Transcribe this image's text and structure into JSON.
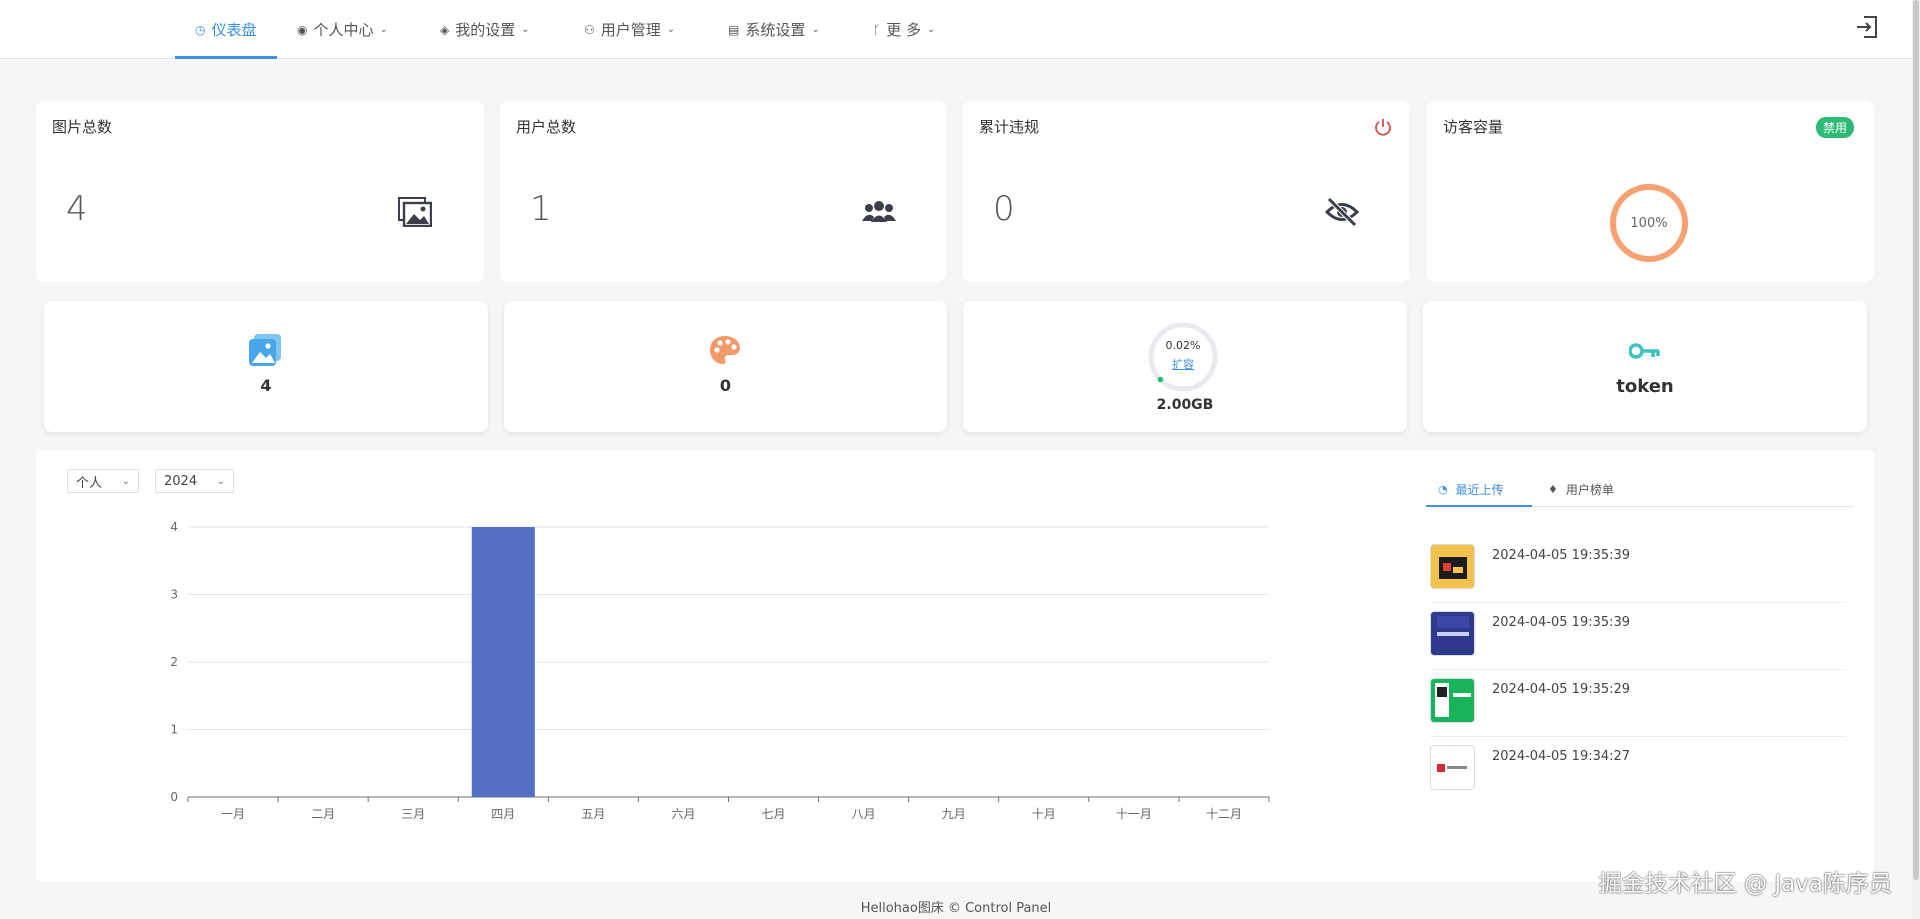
{
  "nav": {
    "items": [
      {
        "label": "仪表盘",
        "icon": "dashboard-icon",
        "active": true
      },
      {
        "label": "个人中心",
        "icon": "user-circle-icon"
      },
      {
        "label": "我的设置",
        "icon": "paint-bucket-icon"
      },
      {
        "label": "用户管理",
        "icon": "users-icon"
      },
      {
        "label": "系统设置",
        "icon": "server-icon"
      },
      {
        "label": "更 多",
        "icon": "branch-icon"
      }
    ]
  },
  "stats": {
    "images": {
      "title": "图片总数",
      "value": "4"
    },
    "users": {
      "title": "用户总数",
      "value": "1"
    },
    "violations": {
      "title": "累计违规",
      "value": "0"
    },
    "visitor": {
      "title": "访客容量",
      "badge": "禁用",
      "percent": "100%"
    }
  },
  "mini": {
    "images": {
      "value": "4"
    },
    "palette": {
      "value": "0"
    },
    "storage": {
      "percent": "0.02%",
      "link": "扩容",
      "value": "2.00GB"
    },
    "token": {
      "value": "token"
    }
  },
  "filters": {
    "scope": "个人",
    "year": "2024"
  },
  "chart_data": {
    "type": "bar",
    "categories": [
      "一月",
      "二月",
      "三月",
      "四月",
      "五月",
      "六月",
      "七月",
      "八月",
      "九月",
      "十月",
      "十一月",
      "十二月"
    ],
    "values": [
      0,
      0,
      0,
      4,
      0,
      0,
      0,
      0,
      0,
      0,
      0,
      0
    ],
    "ylim": [
      0,
      4
    ],
    "yticks": [
      "0",
      "1",
      "2",
      "3",
      "4"
    ],
    "color": "#5470c6",
    "grid": true
  },
  "side": {
    "tabs": [
      {
        "label": "最近上传",
        "active": true
      },
      {
        "label": "用户榜单"
      }
    ],
    "uploads": [
      {
        "time": "2024-04-05 19:35:39"
      },
      {
        "time": "2024-04-05 19:35:39"
      },
      {
        "time": "2024-04-05 19:35:29"
      },
      {
        "time": "2024-04-05 19:34:27"
      }
    ]
  },
  "footer": {
    "text": "Hellohao图床 © Control Panel"
  },
  "watermark": {
    "text": "掘金技术社区 @ Java陈序员"
  }
}
